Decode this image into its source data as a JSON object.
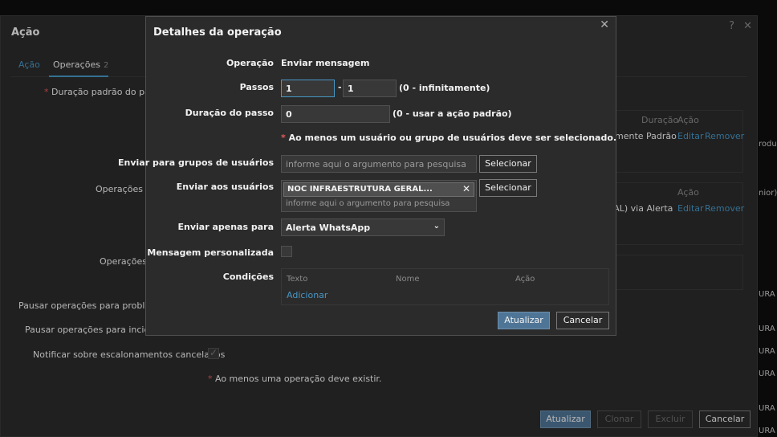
{
  "background": {
    "edge_left_1": "s",
    "edge_left_2": "s",
    "right_1": "roduto",
    "right_2": "nior)",
    "right_3": "URA",
    "right_4": "URA",
    "right_5": "URA",
    "right_6": "URA",
    "right_7": "URA",
    "right_8": "URA"
  },
  "outer": {
    "title": "Ação",
    "help_icon": "help-icon",
    "close_icon": "close-icon",
    "tabs": [
      {
        "label": "Ação"
      },
      {
        "label": "Operações",
        "count": "2"
      }
    ],
    "duracao_label": "Duração padrão do passo",
    "operacoes_label_1": "Operações d",
    "operacoes_label_2": "Operações c",
    "panel1": {
      "col_duracao": "Duração",
      "col_acao": "Ação",
      "cell_text": "mente Padrão",
      "edit": "Editar",
      "remove": "Remover"
    },
    "panel2": {
      "col_acao": "Ação",
      "cell_text": "RAL) via Alerta",
      "edit": "Editar",
      "remove": "Remover"
    },
    "pausar_problema": "Pausar operações para problema",
    "pausar_incidente": "Pausar operações para incident",
    "notificar": "Notificar sobre escalonamentos cancelados",
    "notificar_checked": true,
    "error": "Ao menos uma operação deve existir.",
    "buttons": {
      "atualizar": "Atualizar",
      "clonar": "Clonar",
      "excluir": "Excluir",
      "cancelar": "Cancelar"
    }
  },
  "modal": {
    "title": "Detalhes da operação",
    "close_icon": "close-icon",
    "operacao": {
      "label": "Operação",
      "value": "Enviar mensagem"
    },
    "passos": {
      "label": "Passos",
      "from": "1",
      "sep": "-",
      "to": "1",
      "hint": "(0 - infinitamente)"
    },
    "duracao": {
      "label": "Duração do passo",
      "value": "0",
      "hint": "(0 - usar a ação padrão)"
    },
    "warning": "Ao menos um usuário ou grupo de usuários deve ser selecionado.",
    "grupos": {
      "label": "Enviar para grupos de usuários",
      "placeholder": "informe aqui o argumento para pesquisa",
      "button": "Selecionar"
    },
    "usuarios": {
      "label": "Enviar aos usuários",
      "tag": "NOC INFRAESTRUTURA GERAL (NOC INFRAESTRUTURA GERAL)",
      "placeholder": "informe aqui o argumento para pesquisa",
      "button": "Selecionar"
    },
    "apenas": {
      "label": "Enviar apenas para",
      "selected": "Alerta WhatsApp"
    },
    "personalizada": {
      "label": "Mensagem personalizada",
      "checked": false
    },
    "condicoes": {
      "label": "Condições",
      "col_texto": "Texto",
      "col_nome": "Nome",
      "col_acao": "Ação",
      "add": "Adicionar"
    },
    "buttons": {
      "atualizar": "Atualizar",
      "cancelar": "Cancelar"
    }
  }
}
